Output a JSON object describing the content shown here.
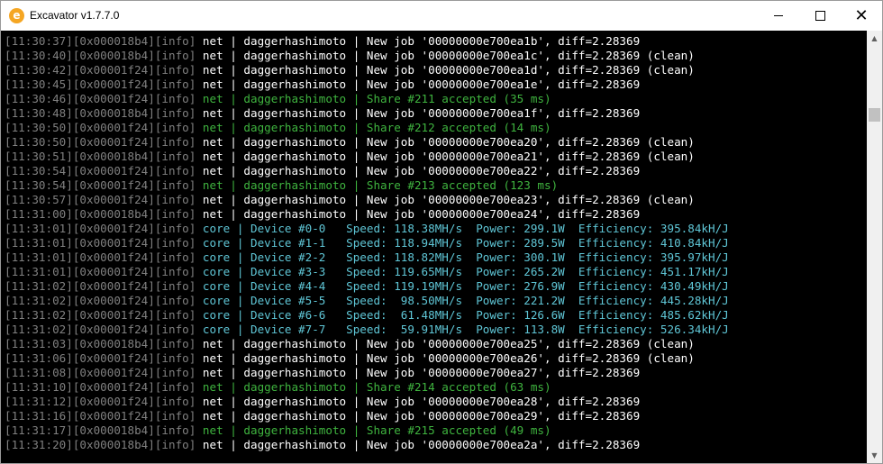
{
  "window": {
    "title": "Excavator v1.7.7.0",
    "icon": "e",
    "controls": {
      "minimize": "minimize-icon",
      "maximize": "maximize-icon",
      "close": "✕"
    }
  },
  "colors": {
    "dim": "#808080",
    "net": "#ffffff",
    "share": "#3fb43f",
    "core": "#5fc6d6",
    "background": "#000000"
  },
  "lines": [
    {
      "type": "net",
      "time": "[11:30:37]",
      "thread": "[0x000018b4]",
      "level": "[info]",
      "body": " net | daggerhashimoto | New job '00000000e700ea1b', diff=2.28369"
    },
    {
      "type": "net",
      "time": "[11:30:40]",
      "thread": "[0x000018b4]",
      "level": "[info]",
      "body": " net | daggerhashimoto | New job '00000000e700ea1c', diff=2.28369 (clean)"
    },
    {
      "type": "net",
      "time": "[11:30:42]",
      "thread": "[0x00001f24]",
      "level": "[info]",
      "body": " net | daggerhashimoto | New job '00000000e700ea1d', diff=2.28369 (clean)"
    },
    {
      "type": "net",
      "time": "[11:30:45]",
      "thread": "[0x00001f24]",
      "level": "[info]",
      "body": " net | daggerhashimoto | New job '00000000e700ea1e', diff=2.28369"
    },
    {
      "type": "share",
      "time": "[11:30:46]",
      "thread": "[0x00001f24]",
      "level": "[info]",
      "body": " net | daggerhashimoto | Share #211 accepted (35 ms)"
    },
    {
      "type": "net",
      "time": "[11:30:48]",
      "thread": "[0x000018b4]",
      "level": "[info]",
      "body": " net | daggerhashimoto | New job '00000000e700ea1f', diff=2.28369"
    },
    {
      "type": "share",
      "time": "[11:30:50]",
      "thread": "[0x00001f24]",
      "level": "[info]",
      "body": " net | daggerhashimoto | Share #212 accepted (14 ms)"
    },
    {
      "type": "net",
      "time": "[11:30:50]",
      "thread": "[0x00001f24]",
      "level": "[info]",
      "body": " net | daggerhashimoto | New job '00000000e700ea20', diff=2.28369 (clean)"
    },
    {
      "type": "net",
      "time": "[11:30:51]",
      "thread": "[0x000018b4]",
      "level": "[info]",
      "body": " net | daggerhashimoto | New job '00000000e700ea21', diff=2.28369 (clean)"
    },
    {
      "type": "net",
      "time": "[11:30:54]",
      "thread": "[0x00001f24]",
      "level": "[info]",
      "body": " net | daggerhashimoto | New job '00000000e700ea22', diff=2.28369"
    },
    {
      "type": "share",
      "time": "[11:30:54]",
      "thread": "[0x00001f24]",
      "level": "[info]",
      "body": " net | daggerhashimoto | Share #213 accepted (123 ms)"
    },
    {
      "type": "net",
      "time": "[11:30:57]",
      "thread": "[0x00001f24]",
      "level": "[info]",
      "body": " net | daggerhashimoto | New job '00000000e700ea23', diff=2.28369 (clean)"
    },
    {
      "type": "net",
      "time": "[11:31:00]",
      "thread": "[0x000018b4]",
      "level": "[info]",
      "body": " net | daggerhashimoto | New job '00000000e700ea24', diff=2.28369"
    },
    {
      "type": "core",
      "time": "[11:31:01]",
      "thread": "[0x00001f24]",
      "level": "[info]",
      "body": " core | Device #0-0   Speed: 118.38MH/s  Power: 299.1W  Efficiency: 395.84kH/J"
    },
    {
      "type": "core",
      "time": "[11:31:01]",
      "thread": "[0x00001f24]",
      "level": "[info]",
      "body": " core | Device #1-1   Speed: 118.94MH/s  Power: 289.5W  Efficiency: 410.84kH/J"
    },
    {
      "type": "core",
      "time": "[11:31:01]",
      "thread": "[0x00001f24]",
      "level": "[info]",
      "body": " core | Device #2-2   Speed: 118.82MH/s  Power: 300.1W  Efficiency: 395.97kH/J"
    },
    {
      "type": "core",
      "time": "[11:31:01]",
      "thread": "[0x00001f24]",
      "level": "[info]",
      "body": " core | Device #3-3   Speed: 119.65MH/s  Power: 265.2W  Efficiency: 451.17kH/J"
    },
    {
      "type": "core",
      "time": "[11:31:02]",
      "thread": "[0x00001f24]",
      "level": "[info]",
      "body": " core | Device #4-4   Speed: 119.19MH/s  Power: 276.9W  Efficiency: 430.49kH/J"
    },
    {
      "type": "core",
      "time": "[11:31:02]",
      "thread": "[0x00001f24]",
      "level": "[info]",
      "body": " core | Device #5-5   Speed:  98.50MH/s  Power: 221.2W  Efficiency: 445.28kH/J"
    },
    {
      "type": "core",
      "time": "[11:31:02]",
      "thread": "[0x00001f24]",
      "level": "[info]",
      "body": " core | Device #6-6   Speed:  61.48MH/s  Power: 126.6W  Efficiency: 485.62kH/J"
    },
    {
      "type": "core",
      "time": "[11:31:02]",
      "thread": "[0x00001f24]",
      "level": "[info]",
      "body": " core | Device #7-7   Speed:  59.91MH/s  Power: 113.8W  Efficiency: 526.34kH/J"
    },
    {
      "type": "net",
      "time": "[11:31:03]",
      "thread": "[0x000018b4]",
      "level": "[info]",
      "body": " net | daggerhashimoto | New job '00000000e700ea25', diff=2.28369 (clean)"
    },
    {
      "type": "net",
      "time": "[11:31:06]",
      "thread": "[0x00001f24]",
      "level": "[info]",
      "body": " net | daggerhashimoto | New job '00000000e700ea26', diff=2.28369 (clean)"
    },
    {
      "type": "net",
      "time": "[11:31:08]",
      "thread": "[0x00001f24]",
      "level": "[info]",
      "body": " net | daggerhashimoto | New job '00000000e700ea27', diff=2.28369"
    },
    {
      "type": "share",
      "time": "[11:31:10]",
      "thread": "[0x00001f24]",
      "level": "[info]",
      "body": " net | daggerhashimoto | Share #214 accepted (63 ms)"
    },
    {
      "type": "net",
      "time": "[11:31:12]",
      "thread": "[0x00001f24]",
      "level": "[info]",
      "body": " net | daggerhashimoto | New job '00000000e700ea28', diff=2.28369"
    },
    {
      "type": "net",
      "time": "[11:31:16]",
      "thread": "[0x00001f24]",
      "level": "[info]",
      "body": " net | daggerhashimoto | New job '00000000e700ea29', diff=2.28369"
    },
    {
      "type": "share",
      "time": "[11:31:17]",
      "thread": "[0x000018b4]",
      "level": "[info]",
      "body": " net | daggerhashimoto | Share #215 accepted (49 ms)"
    },
    {
      "type": "net",
      "time": "[11:31:20]",
      "thread": "[0x000018b4]",
      "level": "[info]",
      "body": " net | daggerhashimoto | New job '00000000e700ea2a', diff=2.28369"
    }
  ]
}
